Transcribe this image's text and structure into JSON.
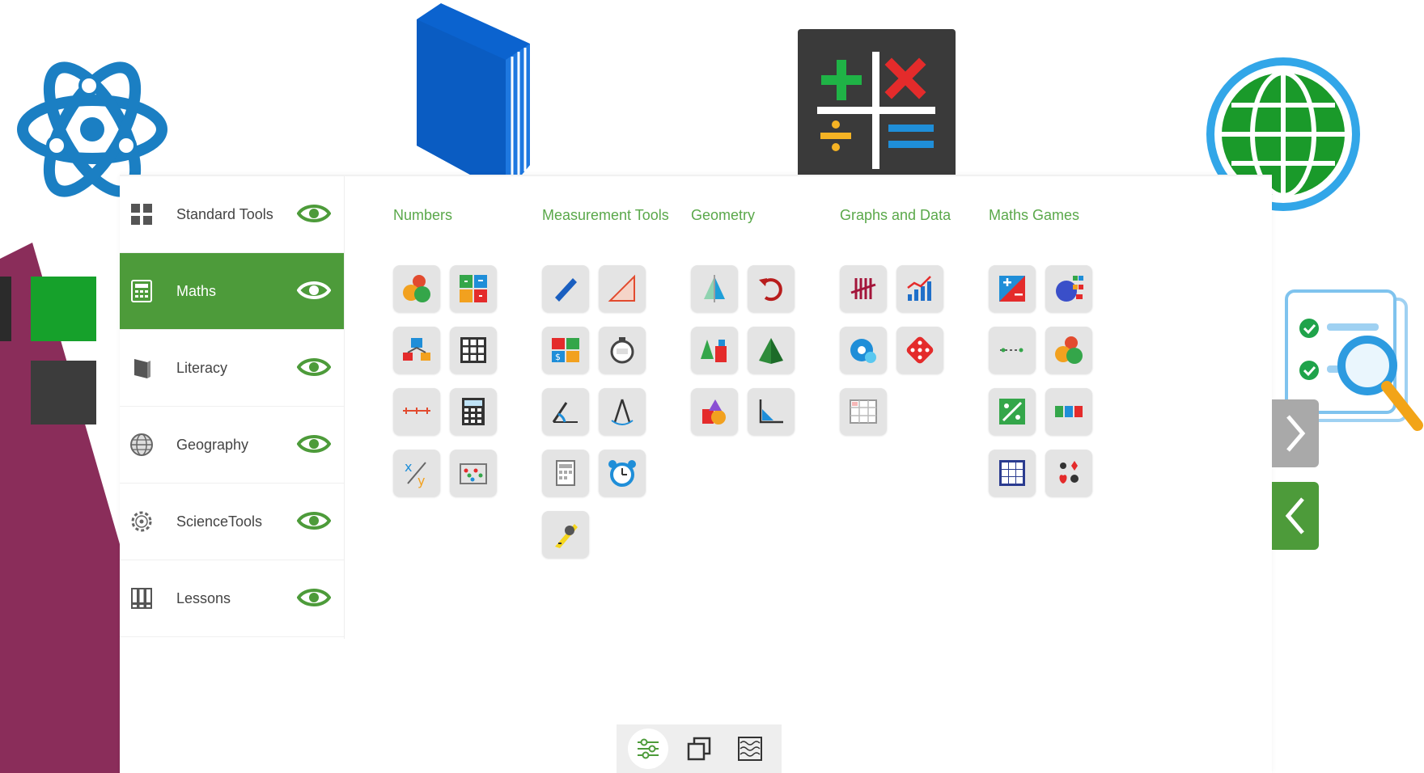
{
  "sidebar": {
    "items": [
      {
        "label": "Standard Tools",
        "icon": "grid-icon",
        "active": false
      },
      {
        "label": "Maths",
        "icon": "calculator-icon",
        "active": true
      },
      {
        "label": "Literacy",
        "icon": "book-icon",
        "active": false
      },
      {
        "label": "Geography",
        "icon": "globe-icon",
        "active": false
      },
      {
        "label": "ScienceTools",
        "icon": "gear-atom-icon",
        "active": false
      },
      {
        "label": "Lessons",
        "icon": "binders-icon",
        "active": false
      }
    ]
  },
  "categories": [
    {
      "title": "Numbers",
      "tools": [
        "counters",
        "number-grid",
        "dominoes",
        "hundred-square",
        "number-line",
        "calculator",
        "fractions",
        "abacus"
      ]
    },
    {
      "title": "Measurement Tools",
      "tools": [
        "ruler",
        "set-square",
        "money",
        "stopwatch",
        "protractor",
        "compass",
        "scales",
        "alarm-clock",
        "tape-measure"
      ]
    },
    {
      "title": "Geometry",
      "tools": [
        "reflection",
        "rotate",
        "shapes-3d",
        "pyramid",
        "shapes",
        "axis"
      ]
    },
    {
      "title": "Graphs and Data",
      "tools": [
        "tally",
        "bar-chart",
        "spinner",
        "dice",
        "table"
      ]
    },
    {
      "title": "Maths Games",
      "tools": [
        "operations-game",
        "number-bonds",
        "number-line-game",
        "counters-game",
        "fraction-game",
        "number-cards",
        "number-grid-game",
        "playing-cards"
      ]
    }
  ],
  "colors": {
    "accent_green": "#4d9b3a",
    "category_title": "#5aa84a",
    "tile_bg": "#e4e4e4",
    "nav_grey": "#a9a9a9"
  },
  "toolbar": {
    "items": [
      "settings-sliders-icon",
      "copy-windows-icon",
      "background-pattern-icon"
    ],
    "active": 0
  }
}
